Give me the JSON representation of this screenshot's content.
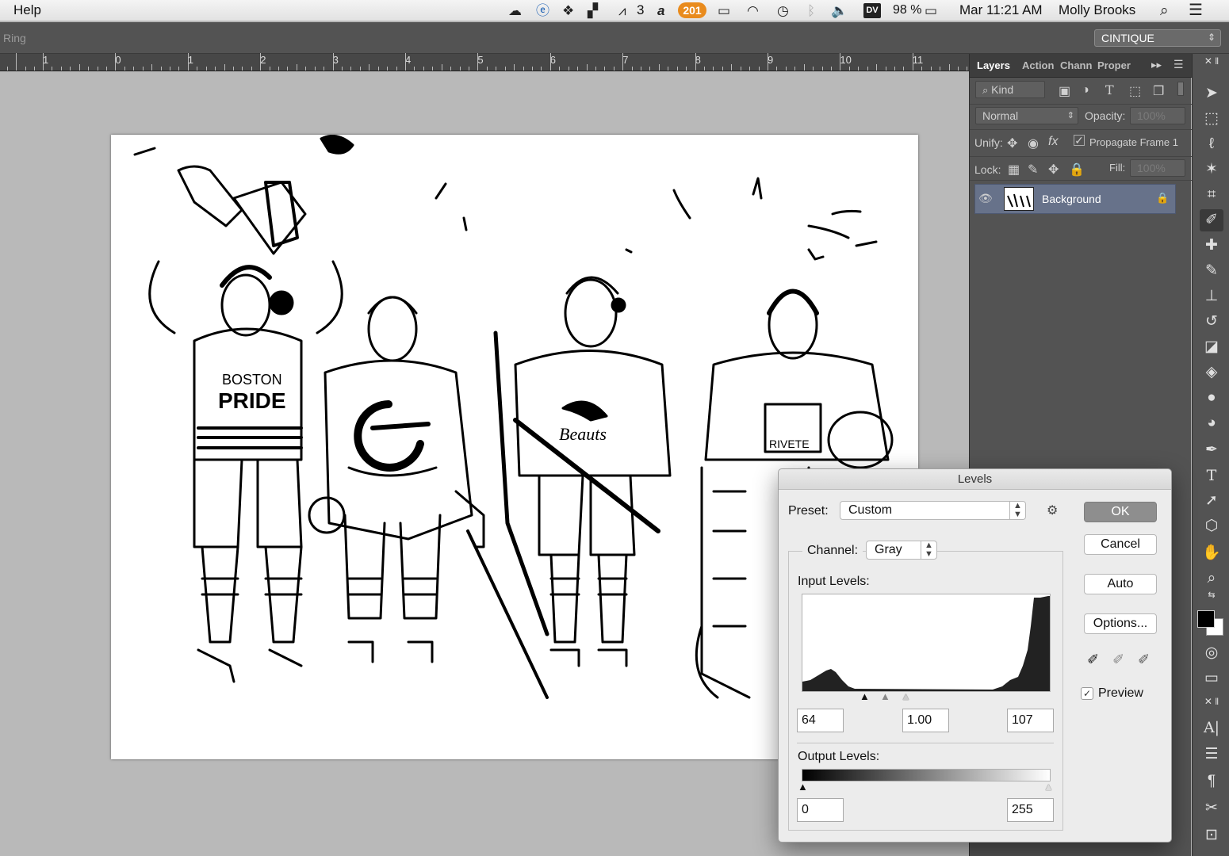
{
  "menubar": {
    "help": "Help",
    "notifications_badge": "201",
    "adobe_count": "3",
    "dv": "DV",
    "battery": "98 %",
    "datetime": "Mar 11:21 AM",
    "user": "Molly Brooks"
  },
  "optionsbar": {
    "tool_title": "Ring",
    "workspace": "CINTIQUE"
  },
  "ruler": {
    "labels": [
      "1",
      "0",
      "1",
      "2",
      "3",
      "4",
      "5",
      "6",
      "7",
      "8",
      "9",
      "10",
      "11"
    ]
  },
  "panels": {
    "tabs": [
      "Layers",
      "Action",
      "Chann",
      "Proper"
    ],
    "kind_filter": "Kind",
    "blend_mode": "Normal",
    "opacity_label": "Opacity:",
    "opacity_value": "100%",
    "unify_label": "Unify:",
    "propagate_label": "Propagate Frame 1",
    "lock_label": "Lock:",
    "fill_label": "Fill:",
    "fill_value": "100%",
    "layer_name": "Background"
  },
  "levels": {
    "title": "Levels",
    "preset_label": "Preset:",
    "preset_value": "Custom",
    "channel_label": "Channel:",
    "channel_value": "Gray",
    "input_levels_label": "Input Levels:",
    "input_black": "64",
    "input_gamma": "1.00",
    "input_white": "107",
    "output_levels_label": "Output Levels:",
    "output_black": "0",
    "output_white": "255",
    "ok": "OK",
    "cancel": "Cancel",
    "auto": "Auto",
    "options": "Options...",
    "preview_label": "Preview",
    "preview_checked": true
  },
  "colors": {
    "badge": "#e98b1d",
    "panel_bg": "#535353",
    "selected_layer": "#67728a",
    "default_button": "#8e8e8e"
  }
}
